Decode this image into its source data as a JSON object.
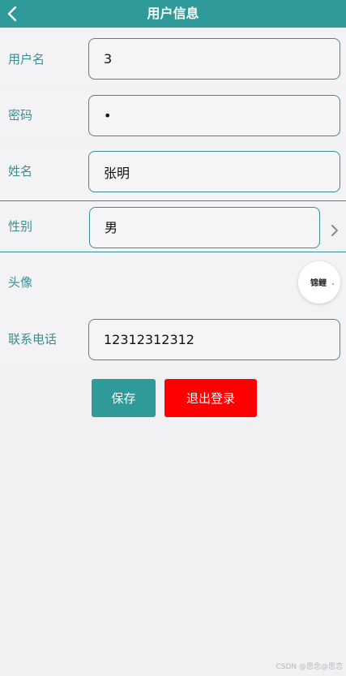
{
  "header": {
    "title": "用户信息",
    "back_icon": "chevron-left-icon"
  },
  "form": {
    "username": {
      "label": "用户名",
      "value": "3"
    },
    "password": {
      "label": "密码",
      "value": "•"
    },
    "name": {
      "label": "姓名",
      "value": "张明"
    },
    "gender": {
      "label": "性别",
      "value": "男",
      "icon": "chevron-right-icon"
    },
    "avatar": {
      "label": "头像",
      "image_text": "锦鲤"
    },
    "phone": {
      "label": "联系电话",
      "value": "12312312312"
    }
  },
  "actions": {
    "save_label": "保存",
    "logout_label": "退出登录"
  },
  "colors": {
    "primary": "#2f9a9a",
    "label": "#3a8e91",
    "danger": "#ff0000",
    "background": "#f1f0f3"
  },
  "watermark": "CSDN @思念@思恋"
}
